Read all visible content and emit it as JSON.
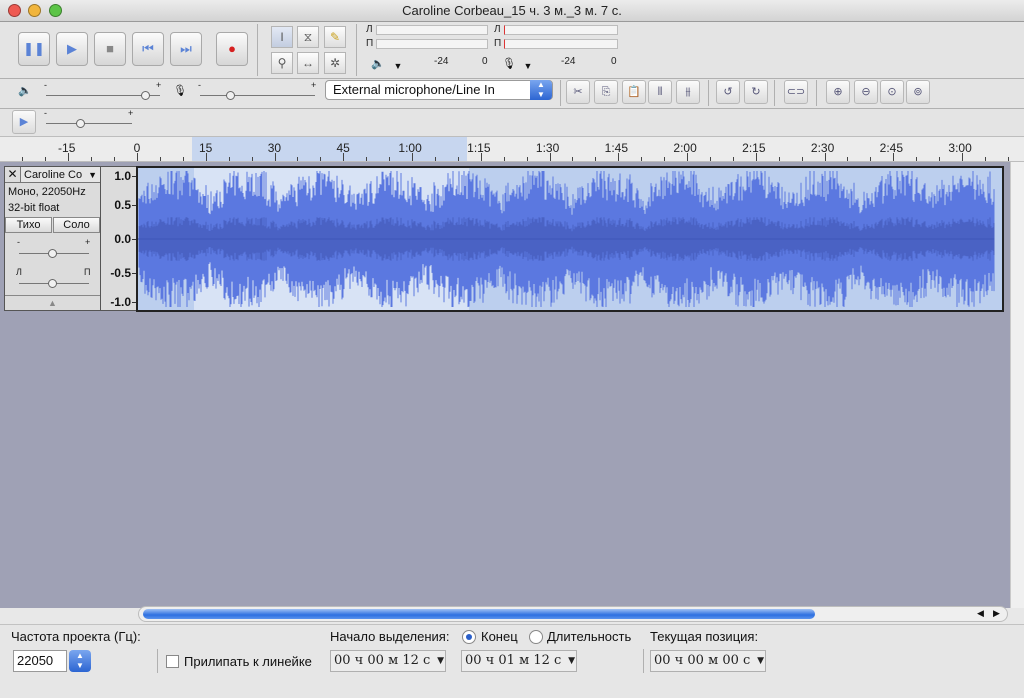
{
  "window": {
    "title": "Caroline Corbeau_15 ч. 3 м._3 м. 7 с."
  },
  "colors": {
    "waveform": "#5b78e0",
    "selection": "#c7d6ef",
    "accent": "#2c65d2",
    "track_background": "#9fa1b5",
    "record": "#d62020"
  },
  "transport": {
    "buttons": [
      {
        "name": "pause-button",
        "icon": "pause-icon",
        "glyph": "❚❚"
      },
      {
        "name": "play-button",
        "icon": "play-icon",
        "glyph": "▶"
      },
      {
        "name": "stop-button",
        "icon": "stop-icon",
        "glyph": "■"
      },
      {
        "name": "skip-start-button",
        "icon": "skip-start-icon",
        "glyph": "⏮"
      },
      {
        "name": "skip-end-button",
        "icon": "skip-end-icon",
        "glyph": "⏭"
      },
      {
        "name": "record-button",
        "icon": "record-icon",
        "glyph": "●"
      }
    ]
  },
  "tools": [
    {
      "name": "selection-tool",
      "icon": "ibeam-icon",
      "glyph": "I"
    },
    {
      "name": "envelope-tool",
      "icon": "envelope-icon",
      "glyph": "⧖"
    },
    {
      "name": "draw-tool",
      "icon": "pencil-icon",
      "glyph": "✎"
    },
    {
      "name": "zoom-tool",
      "icon": "magnifier-icon",
      "glyph": "⚲"
    },
    {
      "name": "timeshift-tool",
      "icon": "timeshift-icon",
      "glyph": "↔"
    },
    {
      "name": "multi-tool",
      "icon": "multi-tool-icon",
      "glyph": "✲"
    }
  ],
  "meters": {
    "playback": {
      "left": "Л",
      "right": "П",
      "tick_mid": "-24",
      "tick_end": "0"
    },
    "record": {
      "left": "Л",
      "right": "П",
      "tick_mid": "-24",
      "tick_end": "0"
    }
  },
  "mixer": {
    "output_volume_level": 0.87,
    "input_volume_level": 0.26,
    "minus": "-",
    "plus": "+",
    "input_device": "External microphone/Line In"
  },
  "edit_tools": [
    {
      "name": "cut-button",
      "icon": "scissors-icon",
      "glyph": "✂"
    },
    {
      "name": "copy-button",
      "icon": "copy-icon",
      "glyph": "⎘"
    },
    {
      "name": "paste-button",
      "icon": "paste-icon",
      "glyph": "📋"
    },
    {
      "name": "trim-button",
      "icon": "trim-icon",
      "glyph": "⫴"
    },
    {
      "name": "silence-button",
      "icon": "silence-icon",
      "glyph": "⫵"
    },
    {
      "name": "undo-button",
      "icon": "undo-icon",
      "glyph": "↺"
    },
    {
      "name": "redo-button",
      "icon": "redo-icon",
      "glyph": "↻"
    },
    {
      "name": "sync-lock-button",
      "icon": "link-icon",
      "glyph": "⊂⊃"
    },
    {
      "name": "zoom-in-button",
      "icon": "zoom-in-icon",
      "glyph": "⊕"
    },
    {
      "name": "zoom-out-button",
      "icon": "zoom-out-icon",
      "glyph": "⊖"
    },
    {
      "name": "fit-selection-button",
      "icon": "fit-selection-icon",
      "glyph": "⊙"
    },
    {
      "name": "fit-project-button",
      "icon": "fit-project-icon",
      "glyph": "⊚"
    }
  ],
  "playat_speed": {
    "minus": "-",
    "plus": "+",
    "level": 0.4
  },
  "ruler": {
    "labels": [
      "-15",
      "0",
      "15",
      "30",
      "45",
      "1:00",
      "1:15",
      "1:30",
      "1:45",
      "2:00",
      "2:15",
      "2:30",
      "2:45",
      "3:00"
    ],
    "seconds": [
      -15,
      0,
      15,
      30,
      45,
      60,
      75,
      90,
      105,
      120,
      135,
      150,
      165,
      180
    ],
    "selection_start_s": 12,
    "selection_end_s": 72
  },
  "track": {
    "name": "Caroline Co",
    "format": "Моно, 22050Hz",
    "bit_depth": "32-bit float",
    "mute": "Тихо",
    "solo": "Соло",
    "gain_minus": "-",
    "gain_plus": "+",
    "pan_left": "Л",
    "pan_right": "П",
    "scale": [
      "1.0",
      "0.5",
      "0.0",
      "-0.5",
      "-1.0"
    ],
    "duration_s": 187
  },
  "status": {
    "rate_label": "Частота проекта (Гц):",
    "rate_value": "22050",
    "snap_label": "Прилипать к линейке",
    "selection_start_label": "Начало выделения:",
    "end_label": "Конец",
    "length_label": "Длительность",
    "position_label": "Текущая позиция:",
    "selection_start": "00 ч 00 м 12 с",
    "selection_end": "00 ч 01 м 12 с",
    "position": "00 ч 00 м 00 с"
  }
}
